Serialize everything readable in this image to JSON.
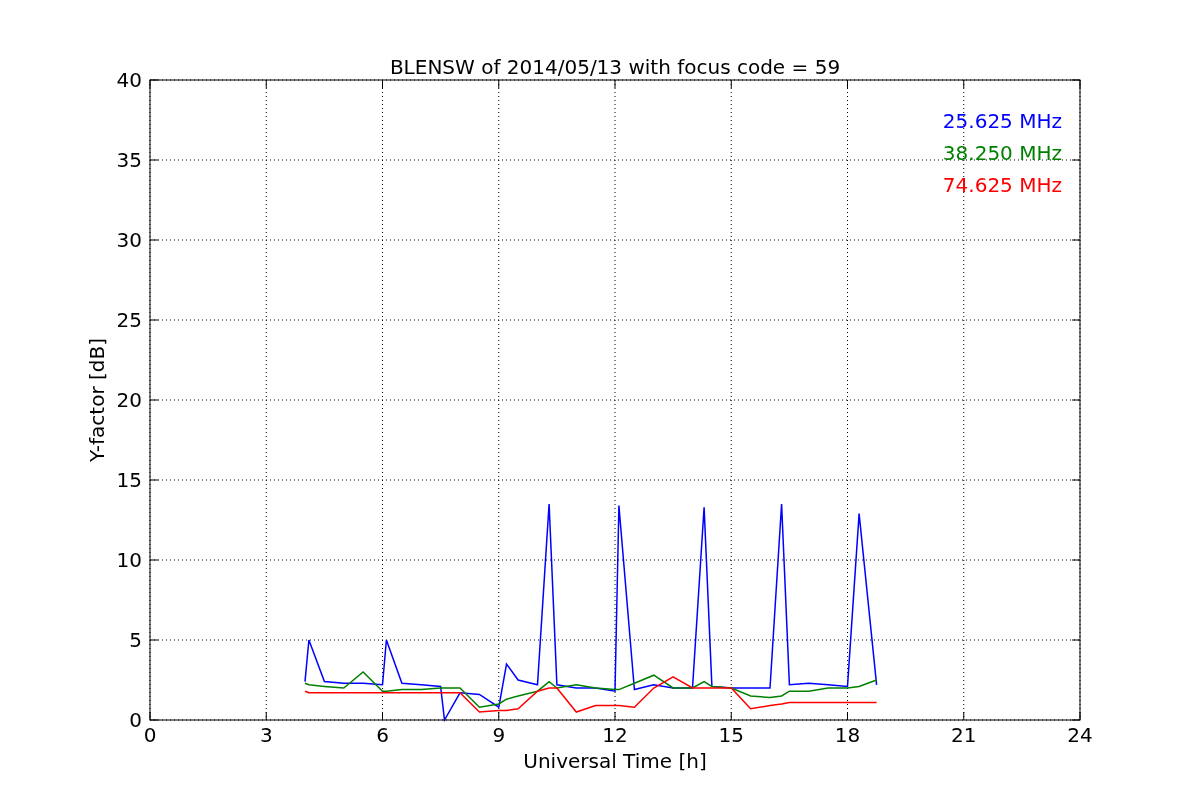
{
  "chart_data": {
    "type": "line",
    "title": "BLENSW of 2014/05/13 with focus code = 59",
    "xlabel": "Universal Time [h]",
    "ylabel": "Y-factor [dB]",
    "x": [
      4,
      4.1,
      4.5,
      5,
      5.5,
      6,
      6.1,
      6.5,
      7,
      7.5,
      7.6,
      8,
      8.5,
      9,
      9.2,
      9.5,
      10,
      10.3,
      10.5,
      11,
      11.5,
      12,
      12.1,
      12.5,
      13,
      13.5,
      14,
      14.3,
      14.5,
      15,
      15.5,
      16,
      16.3,
      16.5,
      17,
      17.5,
      18,
      18.3,
      18.75
    ],
    "series": [
      {
        "name": "25.625 MHz",
        "color": "#0000ff",
        "values": [
          2.4,
          5.0,
          2.4,
          2.3,
          2.3,
          2.2,
          5.0,
          2.3,
          2.2,
          2.1,
          0,
          1.7,
          1.6,
          0.8,
          3.5,
          2.5,
          2.2,
          13.5,
          2.2,
          2.0,
          2.0,
          1.8,
          13.4,
          1.9,
          2.2,
          2.0,
          2.0,
          13.3,
          2.1,
          2.0,
          2.0,
          2.0,
          13.5,
          2.2,
          2.3,
          2.2,
          2.1,
          12.9,
          2.2
        ]
      },
      {
        "name": "38.250 MHz",
        "color": "#008000",
        "values": [
          2.3,
          2.2,
          2.1,
          2.0,
          3.0,
          1.8,
          1.8,
          1.9,
          1.9,
          2.0,
          2.0,
          2.0,
          0.8,
          1.0,
          1.3,
          1.5,
          1.8,
          2.4,
          2.0,
          2.2,
          2.0,
          1.9,
          1.9,
          2.3,
          2.8,
          2.0,
          2.0,
          2.4,
          2.1,
          2.0,
          1.5,
          1.4,
          1.5,
          1.8,
          1.8,
          2.0,
          2.0,
          2.1,
          2.5
        ]
      },
      {
        "name": "74.625 MHz",
        "color": "#ff0000",
        "values": [
          1.8,
          1.7,
          1.7,
          1.7,
          1.7,
          1.7,
          1.7,
          1.7,
          1.7,
          1.7,
          1.7,
          1.7,
          0.5,
          0.6,
          0.6,
          0.7,
          1.8,
          2.0,
          2.0,
          0.5,
          0.9,
          0.9,
          0.9,
          0.8,
          2.0,
          2.7,
          2.0,
          2.0,
          2.0,
          2.0,
          0.7,
          0.9,
          1.0,
          1.1,
          1.1,
          1.1,
          1.1,
          1.1,
          1.1
        ]
      }
    ],
    "xlim": [
      0,
      24
    ],
    "ylim": [
      0,
      40
    ],
    "xticks": [
      0,
      3,
      6,
      9,
      12,
      15,
      18,
      21,
      24
    ],
    "yticks": [
      0,
      5,
      10,
      15,
      20,
      25,
      30,
      35,
      40
    ],
    "grid": true
  }
}
